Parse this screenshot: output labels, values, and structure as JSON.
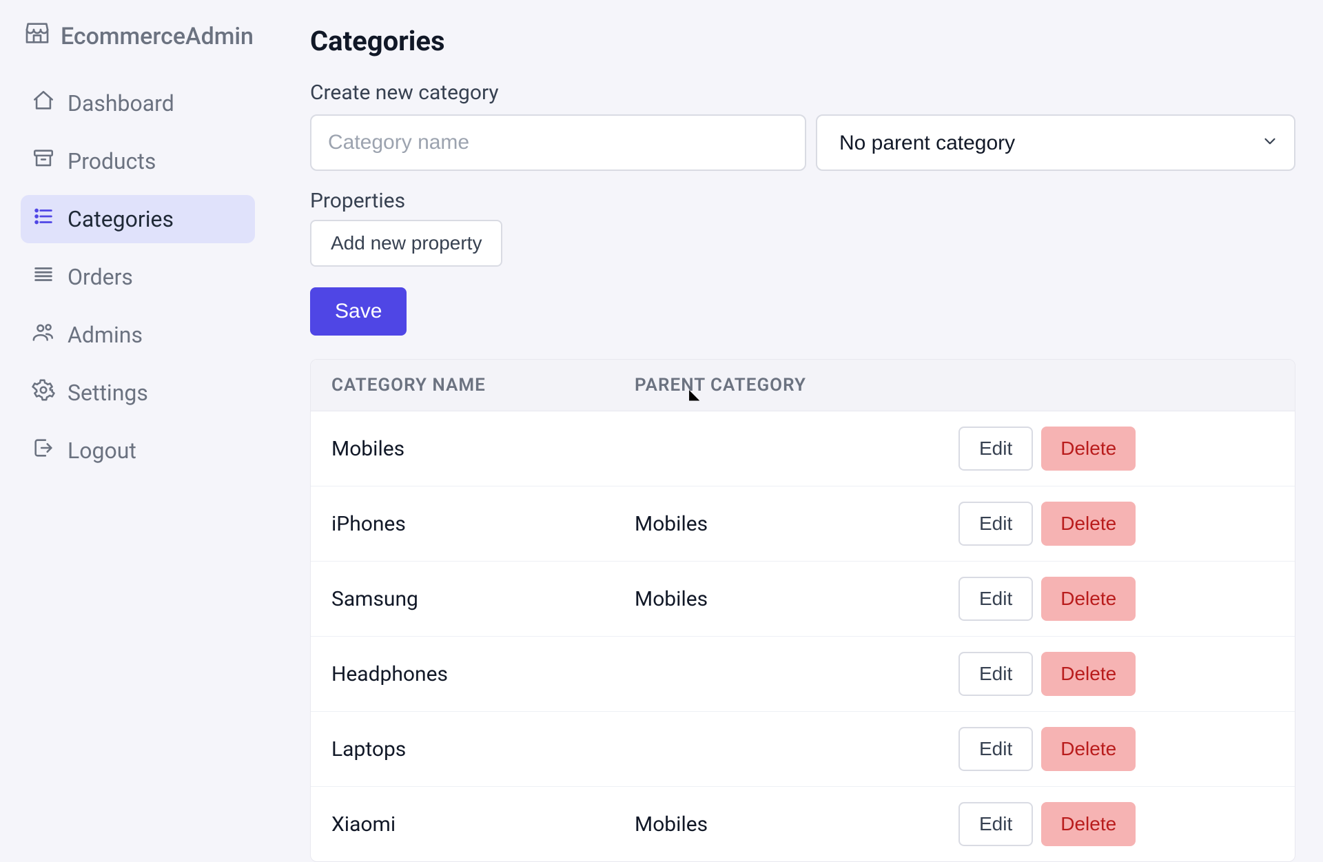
{
  "brand": {
    "name": "EcommerceAdmin"
  },
  "nav": {
    "items": [
      {
        "key": "dashboard",
        "label": "Dashboard",
        "active": false
      },
      {
        "key": "products",
        "label": "Products",
        "active": false
      },
      {
        "key": "categories",
        "label": "Categories",
        "active": true
      },
      {
        "key": "orders",
        "label": "Orders",
        "active": false
      },
      {
        "key": "admins",
        "label": "Admins",
        "active": false
      },
      {
        "key": "settings",
        "label": "Settings",
        "active": false
      },
      {
        "key": "logout",
        "label": "Logout",
        "active": false
      }
    ]
  },
  "page": {
    "title": "Categories",
    "create_label": "Create new category",
    "name_placeholder": "Category name",
    "parent_select_value": "No parent category",
    "properties_label": "Properties",
    "add_property_label": "Add new property",
    "save_label": "Save"
  },
  "table": {
    "columns": [
      "CATEGORY NAME",
      "PARENT CATEGORY"
    ],
    "edit_label": "Edit",
    "delete_label": "Delete",
    "rows": [
      {
        "name": "Mobiles",
        "parent": ""
      },
      {
        "name": "iPhones",
        "parent": "Mobiles"
      },
      {
        "name": "Samsung",
        "parent": "Mobiles"
      },
      {
        "name": "Headphones",
        "parent": ""
      },
      {
        "name": "Laptops",
        "parent": ""
      },
      {
        "name": "Xiaomi",
        "parent": "Mobiles"
      }
    ]
  },
  "colors": {
    "accent": "#4f46e5",
    "danger_bg": "#f6b3b3",
    "danger_fg": "#b91c1c"
  }
}
